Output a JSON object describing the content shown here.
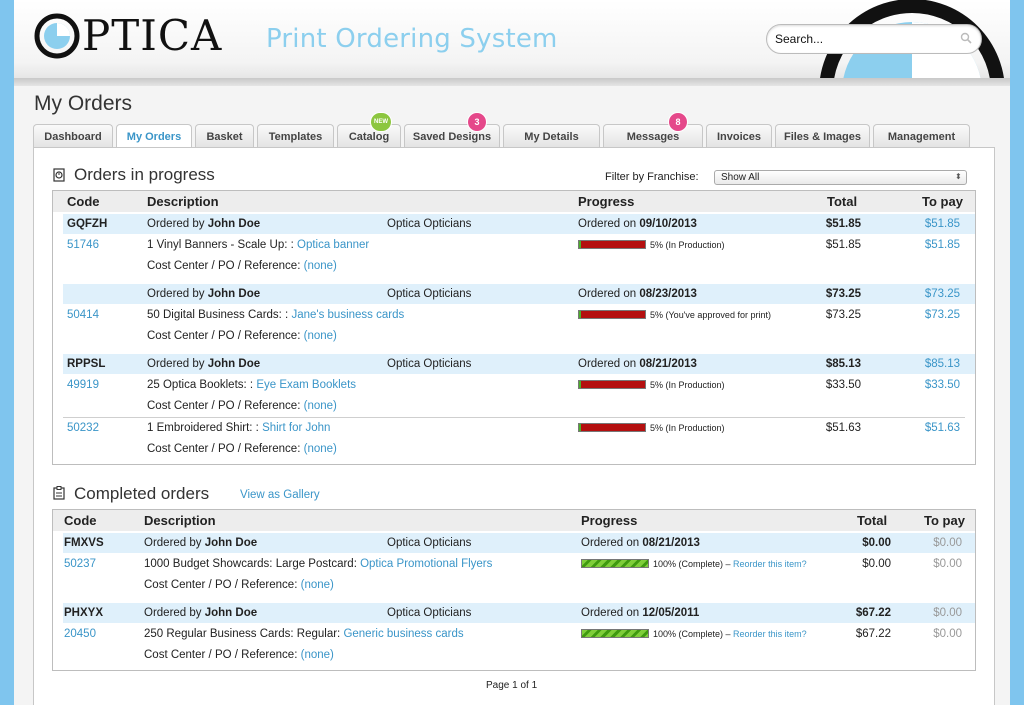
{
  "header": {
    "logo_text": "PTICA",
    "app_title": "Print Ordering System",
    "search_placeholder": "Search..."
  },
  "page_title": "My Orders",
  "tabs": [
    {
      "label": "Dashboard"
    },
    {
      "label": "My Orders",
      "active": true
    },
    {
      "label": "Basket"
    },
    {
      "label": "Templates"
    },
    {
      "label": "Catalog",
      "badge": "NEW"
    },
    {
      "label": "Saved Designs",
      "badge": "3"
    },
    {
      "label": "My Details"
    },
    {
      "label": "Messages",
      "badge": "8"
    },
    {
      "label": "Invoices"
    },
    {
      "label": "Files & Images"
    },
    {
      "label": "Management"
    }
  ],
  "in_progress": {
    "title": "Orders in progress",
    "filter_label": "Filter by Franchise:",
    "filter_value": "Show All",
    "headers": {
      "code": "Code",
      "description": "Description",
      "progress": "Progress",
      "total": "Total",
      "to_pay": "To pay"
    },
    "ordered_by_prefix": "Ordered by",
    "ordered_on_prefix": "Ordered on",
    "cost_center_label": "Cost Center / PO / Reference:",
    "none_label": "(none)",
    "groups": [
      {
        "code": "GQFZH",
        "user": "John Doe",
        "franchise": "Optica Opticians",
        "date": "09/10/2013",
        "total": "$51.85",
        "to_pay": "$51.85",
        "items": [
          {
            "id": "51746",
            "desc": "1 Vinyl Banners - Scale Up: : ",
            "product": "Optica banner",
            "progress_pct": 5,
            "progress_text": "5% (In Production)",
            "total": "$51.85",
            "to_pay": "$51.85"
          }
        ]
      },
      {
        "code": "",
        "user": "John Doe",
        "franchise": "Optica Opticians",
        "date": "08/23/2013",
        "total": "$73.25",
        "to_pay": "$73.25",
        "items": [
          {
            "id": "50414",
            "desc": "50 Digital Business Cards: : ",
            "product": "Jane's business cards",
            "progress_pct": 5,
            "progress_text": "5% (You've approved for print)",
            "total": "$73.25",
            "to_pay": "$73.25"
          }
        ]
      },
      {
        "code": "RPPSL",
        "user": "John Doe",
        "franchise": "Optica Opticians",
        "date": "08/21/2013",
        "total": "$85.13",
        "to_pay": "$85.13",
        "items": [
          {
            "id": "49919",
            "desc": "25 Optica Booklets: : ",
            "product": "Eye Exam Booklets",
            "progress_pct": 5,
            "progress_text": "5% (In Production)",
            "total": "$33.50",
            "to_pay": "$33.50"
          },
          {
            "id": "50232",
            "desc": "1 Embroidered Shirt: : ",
            "product": "Shirt for John",
            "progress_pct": 5,
            "progress_text": "5% (In Production)",
            "total": "$51.63",
            "to_pay": "$51.63"
          }
        ]
      }
    ]
  },
  "completed": {
    "title": "Completed orders",
    "gallery_link": "View as Gallery",
    "headers": {
      "code": "Code",
      "description": "Description",
      "progress": "Progress",
      "total": "Total",
      "to_pay": "To pay"
    },
    "reorder_label": "Reorder this item?",
    "groups": [
      {
        "code": "FMXVS",
        "user": "John Doe",
        "franchise": "Optica Opticians",
        "date": "08/21/2013",
        "total": "$0.00",
        "to_pay": "$0.00",
        "items": [
          {
            "id": "50237",
            "desc": "1000 Budget Showcards: Large Postcard: ",
            "product": "Optica Promotional Flyers",
            "progress_pct": 100,
            "progress_text": "100% (Complete) – ",
            "total": "$0.00",
            "to_pay": "$0.00"
          }
        ]
      },
      {
        "code": "PHXYX",
        "user": "John Doe",
        "franchise": "Optica Opticians",
        "date": "12/05/2011",
        "total": "$67.22",
        "to_pay": "$0.00",
        "items": [
          {
            "id": "20450",
            "desc": "250 Regular Business Cards: Regular: ",
            "product": "Generic business cards",
            "progress_pct": 100,
            "progress_text": "100% (Complete) – ",
            "total": "$67.22",
            "to_pay": "$0.00"
          }
        ]
      }
    ]
  },
  "pager": "Page 1 of 1",
  "colors": {
    "accent": "#3a95c8",
    "badge_pink": "#e5488a",
    "badge_green": "#8cc63f",
    "progress_red": "#b40f0f",
    "progress_green": "#5bb320",
    "row_highlight": "#dff0fb",
    "title_blue": "#8ccfee"
  }
}
